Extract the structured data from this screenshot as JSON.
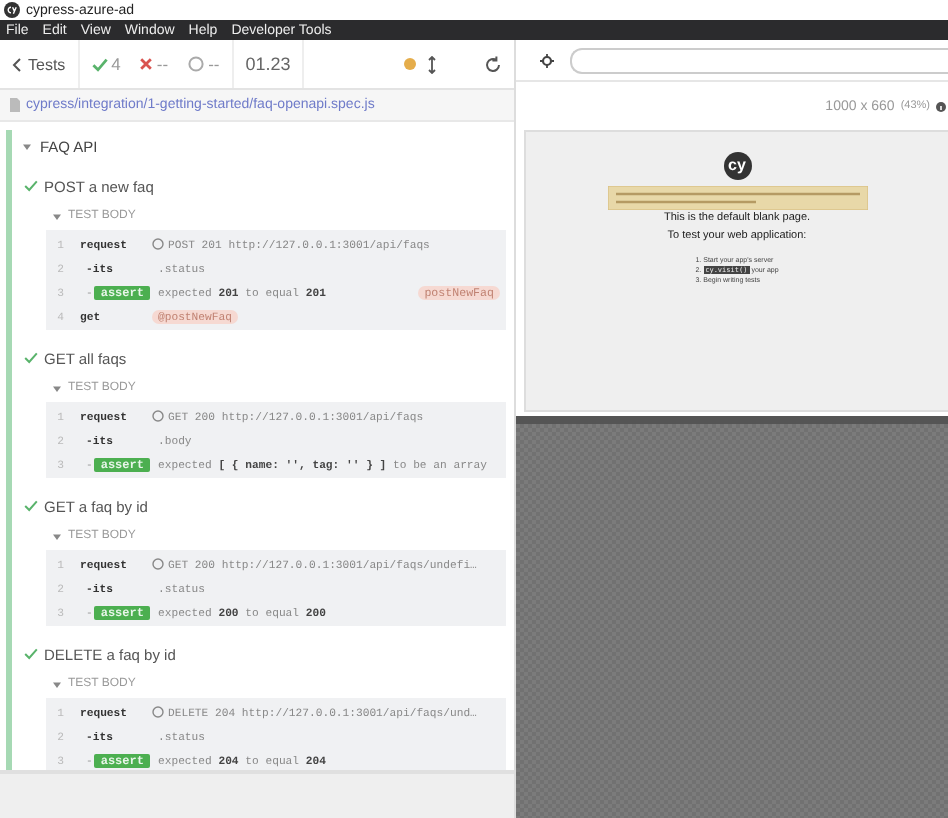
{
  "window": {
    "title": "cypress-azure-ad"
  },
  "menu": [
    "File",
    "Edit",
    "View",
    "Window",
    "Help",
    "Developer Tools"
  ],
  "reporter": {
    "back": "Tests",
    "passed": "4",
    "failed": "--",
    "pending": "--",
    "duration": "01.23",
    "spec_path": "cypress/integration/1-getting-started/faq-openapi.spec.js",
    "suite": {
      "title": "FAQ API",
      "expanded": true,
      "tests": [
        {
          "title": "POST a new faq",
          "passed": true,
          "body_label": "TEST BODY",
          "body_expanded": true,
          "commands": [
            {
              "num": "1",
              "kind": "request",
              "name": "request",
              "message": "POST 201 http://127.0.0.1:3001/api/faqs"
            },
            {
              "num": "2",
              "kind": "child",
              "name": "-its",
              "message": ".status"
            },
            {
              "num": "3",
              "kind": "assert",
              "prefix": "-",
              "name": "assert",
              "message": "expected **201** to equal **201**",
              "alias": "postNewFaq"
            },
            {
              "num": "4",
              "kind": "parent",
              "name": "get",
              "alias_ref": "@postNewFaq"
            }
          ]
        },
        {
          "title": "GET all faqs",
          "passed": true,
          "body_label": "TEST BODY",
          "body_expanded": true,
          "commands": [
            {
              "num": "1",
              "kind": "request",
              "name": "request",
              "message": "GET 200 http://127.0.0.1:3001/api/faqs"
            },
            {
              "num": "2",
              "kind": "child",
              "name": "-its",
              "message": ".body"
            },
            {
              "num": "3",
              "kind": "assert",
              "prefix": "-",
              "name": "assert",
              "message": "expected **[ { name: '', tag: '' } ]** to be an array"
            }
          ]
        },
        {
          "title": "GET a faq by id",
          "passed": true,
          "body_label": "TEST BODY",
          "body_expanded": true,
          "commands": [
            {
              "num": "1",
              "kind": "request",
              "name": "request",
              "message": "GET 200 http://127.0.0.1:3001/api/faqs/undefi…"
            },
            {
              "num": "2",
              "kind": "child",
              "name": "-its",
              "message": ".status"
            },
            {
              "num": "3",
              "kind": "assert",
              "prefix": "-",
              "name": "assert",
              "message": "expected **200** to equal **200**"
            }
          ]
        },
        {
          "title": "DELETE a faq by id",
          "passed": true,
          "body_label": "TEST BODY",
          "body_expanded": true,
          "commands": [
            {
              "num": "1",
              "kind": "request",
              "name": "request",
              "message": "DELETE 204 http://127.0.0.1:3001/api/faqs/und…"
            },
            {
              "num": "2",
              "kind": "child",
              "name": "-its",
              "message": ".status"
            },
            {
              "num": "3",
              "kind": "assert",
              "prefix": "-",
              "name": "assert",
              "message": "expected **204** to equal **204**"
            }
          ]
        }
      ]
    }
  },
  "runner": {
    "viewport": "1000 x 660",
    "scale": "(43%)",
    "preview": {
      "logo": "cy",
      "heading": [
        "This is the default blank page.",
        "To test your web application:"
      ],
      "steps": [
        {
          "num": "1.",
          "text": "Start your app's server"
        },
        {
          "num": "2.",
          "code": "cy.visit()",
          "text": "your app"
        },
        {
          "num": "3.",
          "text": "Begin writing tests"
        }
      ]
    }
  }
}
